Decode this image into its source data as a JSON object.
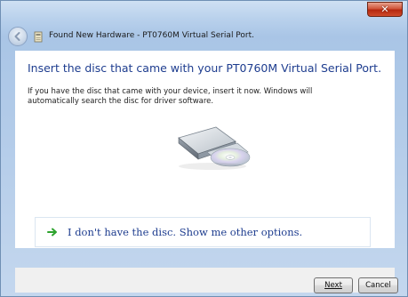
{
  "window": {
    "title": "Found New Hardware - PT0760M Virtual Serial Port.",
    "close_glyph": "✕"
  },
  "main": {
    "heading": "Insert the disc that came with your PT0760M Virtual Serial Port.",
    "instructions": "If you have the disc that came with your device, insert it now.  Windows will automatically search the disc for driver software.",
    "illustration_icon": "disc-drive-icon",
    "option_label": "I don't have the disc.  Show me other options.",
    "option_icon": "green-arrow-icon"
  },
  "footer": {
    "next_label": "Next",
    "cancel_label": "Cancel"
  },
  "colors": {
    "heading": "#1e3d8f",
    "link": "#1e3d8f",
    "arrow": "#2ea32e",
    "close_button": "#c8432a"
  }
}
